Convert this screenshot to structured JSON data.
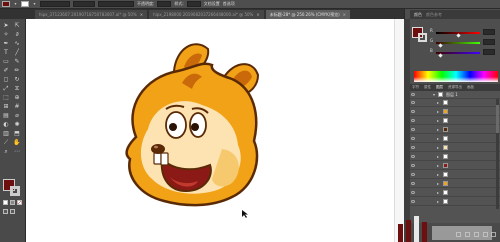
{
  "control_bar": {
    "label_fill": "",
    "opacity_label": "不透明度:",
    "style_label": "样式:",
    "doc_setup": "文档设置",
    "prefs": "首选项"
  },
  "tabs": [
    {
      "label": "hipx_37123607 20190718750783007.ai* @ 50%",
      "active": false
    },
    {
      "label": "hipx_2198000 2019082037266448000.ai* @ 50%",
      "active": false
    },
    {
      "label": "未标题-28* @ 250.26% (CMYK/预览)",
      "active": true
    }
  ],
  "panel_tabs": [
    "颜色",
    "颜色参考"
  ],
  "color": {
    "channels": [
      {
        "name": "R",
        "value": ""
      },
      {
        "name": "G",
        "value": ""
      },
      {
        "name": "B",
        "value": ""
      }
    ],
    "hex": "#6d0f0f"
  },
  "mid_tabs": [
    "字符",
    "属性",
    "图层",
    "资源导出",
    "画板"
  ],
  "layers": {
    "top_layer": "图层 1",
    "rows": [
      "",
      "",
      "",
      "",
      "",
      "",
      "",
      "",
      "",
      "",
      "",
      ""
    ]
  },
  "colors": {
    "fill": "#6d0f0f",
    "fur": "#f2a216",
    "fur_dark": "#c9690a",
    "face": "#fde3b1",
    "outline": "#5a2a06",
    "mouth": "#8b1a16"
  }
}
